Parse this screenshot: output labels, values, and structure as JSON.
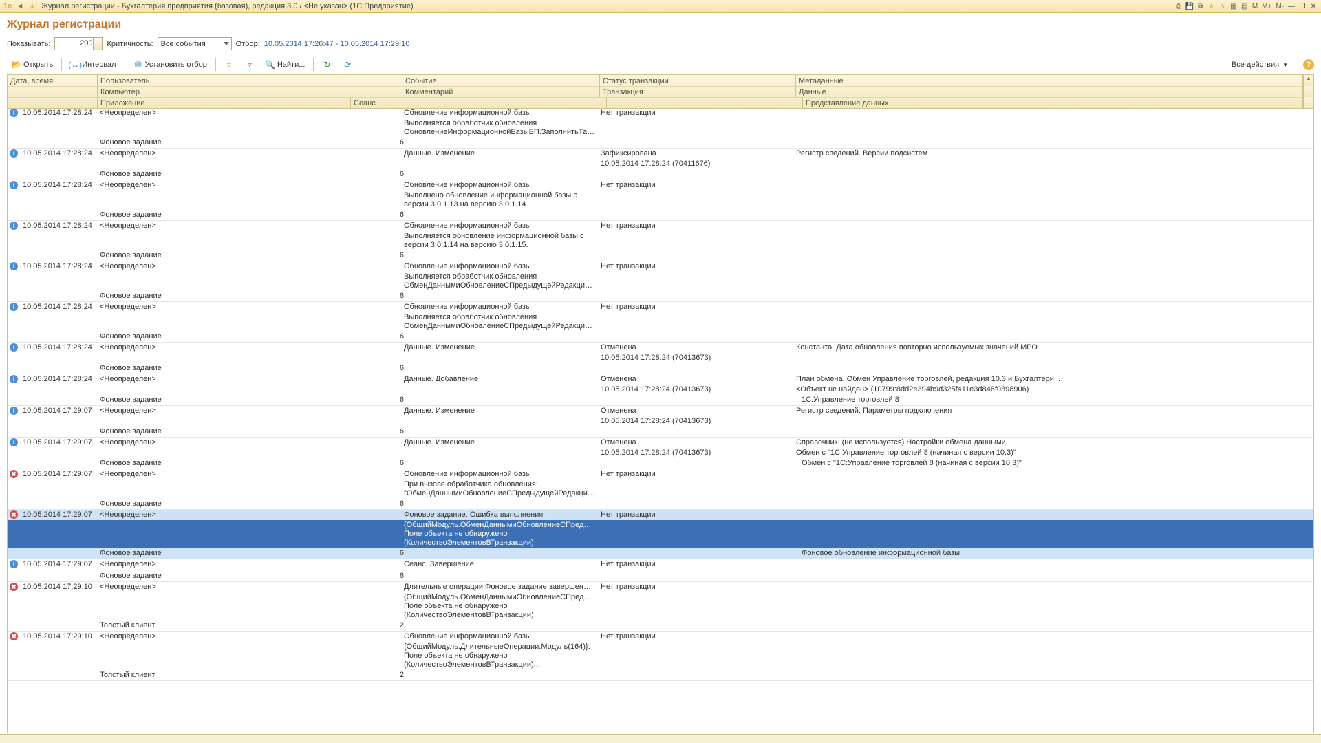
{
  "titlebar": {
    "title": "Журнал регистрации - Бухгалтерия предприятия (базовая), редакция 3.0 / <Не указан>  (1С:Предприятие)",
    "m_labels": [
      "M",
      "M+",
      "M-"
    ]
  },
  "page": {
    "title": "Журнал регистрации"
  },
  "filterbar": {
    "show_label": "Показывать:",
    "show_value": "200",
    "crit_label": "Критичность:",
    "crit_value": "Все события",
    "filter_label": "Отбор:",
    "filter_link": "10.05.2014 17:26:47 - 10.05.2014 17:29:10"
  },
  "toolbar": {
    "open": "Открыть",
    "interval": "Интервал",
    "set_filter": "Установить отбор",
    "find": "Найти...",
    "all_actions": "Все действия"
  },
  "headers": {
    "date": "Дата, время",
    "user": "Пользователь",
    "event": "Событие",
    "tx_status": "Статус транзакции",
    "metadata": "Метаданные",
    "computer": "Компьютер",
    "comment": "Комментарий",
    "transaction": "Транзакция",
    "data": "Данные",
    "application": "Приложение",
    "session": "Сеанс",
    "data_repr": "Представление данных"
  },
  "rows": [
    {
      "icon": "info",
      "date": "10.05.2014 17:28:24",
      "user": "<Неопределен>",
      "event": "Обновление информационной базы",
      "txs": "Нет транзакции",
      "meta": "",
      "comment": "Выполняется обработчик обновления ОбновлениеИнформационнойБазыБП.ЗаполнитьТабличныеЧастиР...",
      "tx": "",
      "data": "",
      "app": "Фоновое задание",
      "sess": "6",
      "repr": ""
    },
    {
      "icon": "info",
      "date": "10.05.2014 17:28:24",
      "user": "<Неопределен>",
      "event": "Данные. Изменение",
      "txs": "Зафиксирована",
      "meta": "Регистр сведений. Версии подсистем",
      "comment": "",
      "tx": "10.05.2014 17:28:24 (70411676)",
      "data": "",
      "app": "Фоновое задание",
      "sess": "6",
      "repr": ""
    },
    {
      "icon": "info",
      "date": "10.05.2014 17:28:24",
      "user": "<Неопределен>",
      "event": "Обновление информационной базы",
      "txs": "Нет транзакции",
      "meta": "",
      "comment": "Выполнено обновление информационной базы с версии 3.0.1.13 на версию 3.0.1.14.",
      "tx": "",
      "data": "",
      "app": "Фоновое задание",
      "sess": "6",
      "repr": ""
    },
    {
      "icon": "info",
      "date": "10.05.2014 17:28:24",
      "user": "<Неопределен>",
      "event": "Обновление информационной базы",
      "txs": "Нет транзакции",
      "meta": "",
      "comment": "Выполняется обновление информационной базы с версии 3.0.1.14 на версию 3.0.1.15.",
      "tx": "",
      "data": "",
      "app": "Фоновое задание",
      "sess": "6",
      "repr": ""
    },
    {
      "icon": "info",
      "date": "10.05.2014 17:28:24",
      "user": "<Неопределен>",
      "event": "Обновление информационной базы",
      "txs": "Нет транзакции",
      "meta": "",
      "comment": "Выполняется обработчик обновления ОбменДаннымиОбновлениеСПредыдущейРедакции.ВыполнитьПер...",
      "tx": "",
      "data": "",
      "app": "Фоновое задание",
      "sess": "6",
      "repr": ""
    },
    {
      "icon": "info",
      "date": "10.05.2014 17:28:24",
      "user": "<Неопределен>",
      "event": "Обновление информационной базы",
      "txs": "Нет транзакции",
      "meta": "",
      "comment": "Выполняется обработчик обновления ОбменДаннымиОбновлениеСПредыдущейРедакции.ВыполнитьПер...",
      "tx": "",
      "data": "",
      "app": "Фоновое задание",
      "sess": "6",
      "repr": ""
    },
    {
      "icon": "info",
      "date": "10.05.2014 17:28:24",
      "user": "<Неопределен>",
      "event": "Данные. Изменение",
      "txs": "Отменена",
      "meta": "Константа. Дата обновления повторно используемых значений МРО",
      "comment": "",
      "tx": "10.05.2014 17:28:24 (70413673)",
      "data": "",
      "app": "Фоновое задание",
      "sess": "6",
      "repr": ""
    },
    {
      "icon": "info",
      "date": "10.05.2014 17:28:24",
      "user": "<Неопределен>",
      "event": "Данные. Добавление",
      "txs": "Отменена",
      "meta": "План обмена. Обмен Управление торговлей, редакция 10.3 и Бухгалтери...",
      "comment": "",
      "tx": "10.05.2014 17:28:24 (70413673)",
      "data": "<Объект не найден> (10799:8dd2e394b9d325f411e3d846f0398906)",
      "app": "Фоновое задание",
      "sess": "6",
      "repr": "1С:Управление торговлей 8"
    },
    {
      "icon": "info",
      "date": "10.05.2014 17:29:07",
      "user": "<Неопределен>",
      "event": "Данные. Изменение",
      "txs": "Отменена",
      "meta": "Регистр сведений. Параметры подключения",
      "comment": "",
      "tx": "10.05.2014 17:28:24 (70413673)",
      "data": "",
      "app": "Фоновое задание",
      "sess": "6",
      "repr": ""
    },
    {
      "icon": "info",
      "date": "10.05.2014 17:29:07",
      "user": "<Неопределен>",
      "event": "Данные. Изменение",
      "txs": "Отменена",
      "meta": "Справочник. (не используется) Настройки обмена данными",
      "comment": "",
      "tx": "10.05.2014 17:28:24 (70413673)",
      "data": "Обмен с \"1С:Управление торговлей 8 (начиная с версии 10.3)\"",
      "app": "Фоновое задание",
      "sess": "6",
      "repr": "Обмен с \"1С:Управление торговлей 8 (начиная с версии 10.3)\""
    },
    {
      "icon": "error",
      "date": "10.05.2014 17:29:07",
      "user": "<Неопределен>",
      "event": "Обновление информационной базы",
      "txs": "Нет транзакции",
      "meta": "",
      "comment": "При вызове обработчика обновления: \"ОбменДаннымиОбновлениеСПредыдущейРедакции.ВыполнитьПе...",
      "tx": "",
      "data": "",
      "app": "Фоновое задание",
      "sess": "6",
      "repr": ""
    },
    {
      "icon": "error",
      "date": "10.05.2014 17:29:07",
      "user": "<Неопределен>",
      "event": "Фоновое задание. Ошибка выполнения",
      "txs": "Нет транзакции",
      "meta": "",
      "comment": "{ОбщийМодуль.ОбменДаннымиОбновлениеСПредыдущейРедакции... Поле объекта не обнаружено (КоличествоЭлементовВТранзакции)",
      "tx": "",
      "data": "",
      "app": "Фоновое задание",
      "sess": "6",
      "repr": "Фоновое обновление информационной базы",
      "selected": true
    },
    {
      "icon": "info",
      "date": "10.05.2014 17:29:07",
      "user": "<Неопределен>",
      "event": "Сеанс. Завершение",
      "txs": "Нет транзакции",
      "meta": "",
      "comment": "",
      "tx": "",
      "data": "",
      "app": "Фоновое задание",
      "sess": "6",
      "repr": ""
    },
    {
      "icon": "error",
      "date": "10.05.2014 17:29:10",
      "user": "<Неопределен>",
      "event": "Длительные операции.Фоновое задание завершено аварийно",
      "txs": "Нет транзакции",
      "meta": "",
      "comment": "{ОбщийМодуль.ОбменДаннымиОбновлениеСПредыдущейРедакции... Поле объекта не обнаружено (КоличествоЭлементовВТранзакции)",
      "tx": "",
      "data": "",
      "app": "Толстый клиент",
      "sess": "2",
      "repr": ""
    },
    {
      "icon": "error",
      "date": "10.05.2014 17:29:10",
      "user": "<Неопределен>",
      "event": "Обновление информационной базы",
      "txs": "Нет транзакции",
      "meta": "",
      "comment": "{ОбщийМодуль.ДлительныеОперации.Модуль(164)}: Поле объекта не обнаружено (КоличествоЭлементовВТранзакции)...",
      "tx": "",
      "data": "",
      "app": "Толстый клиент",
      "sess": "2",
      "repr": ""
    }
  ]
}
